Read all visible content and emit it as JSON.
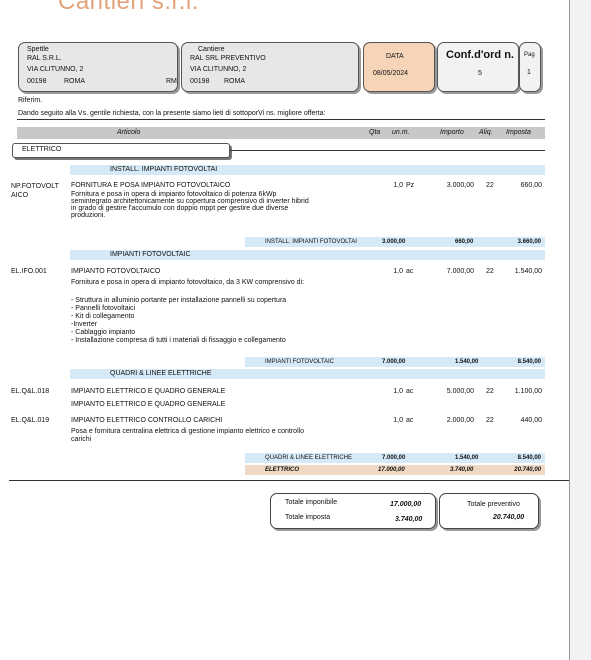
{
  "company": {
    "name": "Cantieri s.r.l."
  },
  "header": {
    "spett": {
      "label": "Spettle",
      "name": "RAL S.R.L.",
      "address": "VIA CLITUNNO, 2",
      "cap": "00198",
      "city": "ROMA",
      "prov": "RM"
    },
    "cantiere": {
      "label": "Cantiere",
      "name": "RAL SRL PREVENTIVO",
      "address": "VIA CLITUNNO, 2",
      "cap": "00198",
      "city": "ROMA"
    },
    "date": {
      "label": "DATA",
      "value": "08/05/2024"
    },
    "conf": {
      "label": "Conf.d'ord n.",
      "value": "5"
    },
    "page": {
      "label": "Pag",
      "value": "1"
    }
  },
  "intro": {
    "riferim": "Riferim.",
    "text": "Dando seguito alla Vs. gentile richiesta, con la presente siamo lieti di sottoporVi ns. migliore offerta:"
  },
  "columns": {
    "articolo": "Articolo",
    "qta": "Qta",
    "um": "un.m.",
    "importo": "Importo",
    "aliq": "Aliq.",
    "imposta": "Imposta"
  },
  "section": "ELETTRICO",
  "groups": [
    {
      "title": "INSTALL. IMPIANTI FOTOVOLTAI"
    },
    {
      "title": "IMPIANTI FOTOVOLTAIC"
    },
    {
      "title": "QUADRI & LINEE ELETTRICHE"
    }
  ],
  "items": [
    {
      "code": "NP.FOTOVOLT AICO",
      "title": "FORNITURA E POSA IMPIANTO FOTOVOLTAICO",
      "desc": [
        "Fornitura e posa in opera di impianto fotovoltaico di potenza 6kWp",
        "semintegrato architettonicamente su copertura comprensivo di inverter hibrid",
        "in grado di gestire l'accumulo con doppio mppt per gestire due diverse",
        "produzioni."
      ],
      "qta": "1,0",
      "um": "Pz",
      "importo": "3.000,00",
      "aliq": "22",
      "imposta": "660,00"
    },
    {
      "code": "EL.IFO.001",
      "title": "IMPIANTO FOTOVOLTAICO",
      "desc": [
        "Fornitura e posa in opera di impianto fotovoltaico, da 3 KW comprensivo di:",
        "",
        "- Struttura in alluminio portante per installazione pannelli su copertura",
        "- Pannelli fotovoltaici",
        "- Kit di collegamento",
        "-Inverter",
        "- Cablaggio impianto",
        "- Installazione compresa di tutti i materiali di fissaggio e collegamento"
      ],
      "qta": "1,0",
      "um": "ac",
      "importo": "7.000,00",
      "aliq": "22",
      "imposta": "1.540,00"
    },
    {
      "code": "EL.Q&L.018",
      "title": "IMPIANTO ELETTRICO E QUADRO GENERALE",
      "desc": [
        "IMPIANTO ELETTRICO E QUADRO GENERALE"
      ],
      "qta": "1,0",
      "um": "ac",
      "importo": "5.000,00",
      "aliq": "22",
      "imposta": "1.100,00"
    },
    {
      "code": "EL.Q&L.019",
      "title": "IMPIANTO ELETTRICO CONTROLLO CARICHI",
      "desc": [
        "Posa e fornitura centralina elettrica di gestione impianto elettrico e controllo",
        "carichi"
      ],
      "qta": "1,0",
      "um": "ac",
      "importo": "2.000,00",
      "aliq": "22",
      "imposta": "440,00"
    }
  ],
  "subtotals": [
    {
      "label": "INSTALL. IMPIANTI FOTOVOLTAI",
      "importo": "3.000,00",
      "imposta": "660,00",
      "totale": "3.660,00"
    },
    {
      "label": "IMPIANTI FOTOVOLTAIC",
      "importo": "7.000,00",
      "imposta": "1.540,00",
      "totale": "8.540,00"
    },
    {
      "label": "QUADRI & LINEE ELETTRICHE",
      "importo": "7.000,00",
      "imposta": "1.540,00",
      "totale": "8.540,00"
    }
  ],
  "section_total": {
    "label": "ELETTRICO",
    "importo": "17.000,00",
    "imposta": "3.740,00",
    "totale": "20.740,00"
  },
  "totals": {
    "imponibile_label": "Totale imponibile",
    "imponibile": "17.000,00",
    "imposta_label": "Totale imposta",
    "imposta": "3.740,00",
    "preventivo_label": "Totale preventivo",
    "preventivo": "20.740,00"
  },
  "colors": {
    "band": "#d6e9f7",
    "total": "#f0d9c4",
    "date_box": "#f6d4b8",
    "brand": "#e3a37a"
  }
}
